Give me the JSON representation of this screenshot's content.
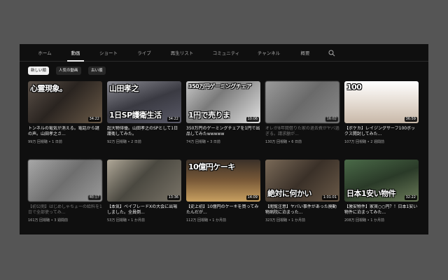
{
  "tabs": [
    {
      "label": "ホーム",
      "active": false
    },
    {
      "label": "動画",
      "active": true
    },
    {
      "label": "ショート",
      "active": false
    },
    {
      "label": "ライブ",
      "active": false
    },
    {
      "label": "再生リスト",
      "active": false
    },
    {
      "label": "コミュニティ",
      "active": false
    },
    {
      "label": "チャンネル",
      "active": false
    },
    {
      "label": "概要",
      "active": false
    }
  ],
  "search_icon": "search-icon",
  "chips": [
    {
      "label": "新しい順",
      "selected": true
    },
    {
      "label": "人気の動画",
      "selected": false
    },
    {
      "label": "古い順",
      "selected": false
    }
  ],
  "videos": [
    {
      "thumb_text": "心霊現象。",
      "thumb_text2": "",
      "duration": "34:22",
      "title": "トンネルの電気が消える。電話から謎の声。山田孝之さ...",
      "views": "99万 回視聴",
      "age": "1 日前",
      "dim": false
    },
    {
      "thumb_text": "山田孝之",
      "thumb_text2": "1日SP護衛生活",
      "duration": "34:22",
      "title": "超大物俳優。山田孝之のSPとして1日護衛してみた。",
      "views": "92万 回視聴",
      "age": "2 日前",
      "dim": false
    },
    {
      "thumb_text": "350万円ゲーミングチェア",
      "thumb_text2": "1円で売りま",
      "duration": "10:06",
      "title": "350万円のゲーミングチェアを1円で出品してみたwwwww",
      "views": "74万 回視聴",
      "age": "3 日前",
      "dim": false
    },
    {
      "thumb_text": "",
      "thumb_text2": "",
      "duration": "16:02",
      "title": "オレが8年間借りた家の退去費がヤバ過ぎる。請求額が...",
      "views": "130万 回視聴",
      "age": "6 日前",
      "dim": true
    },
    {
      "thumb_text": "100",
      "thumb_text2": "",
      "duration": "36:59",
      "title": "【ポケカ】レイジングサーフ100ボックス開封してみた...",
      "views": "107万 回視聴",
      "age": "2 週間前",
      "dim": false
    },
    {
      "thumb_text": "",
      "thumb_text2": "",
      "duration": "40:17",
      "title": "【初公開】はじめしゃちょーの給料を1日で全部使ってみ...",
      "views": "161万 回視聴",
      "age": "3 週間前",
      "dim": true
    },
    {
      "thumb_text": "",
      "thumb_text2": "",
      "duration": "13:36",
      "title": "【本気】ベイブレードXの大会に出場しました。全員倒...",
      "views": "53万 回視聴",
      "age": "1 か月前",
      "dim": false
    },
    {
      "thumb_text": "10億円ケーキ",
      "thumb_text2": "",
      "duration": "14:09",
      "title": "【史上初】10億円のケーキを買ってみたんだが...",
      "views": "112万 回視聴",
      "age": "1 か月前",
      "dim": false
    },
    {
      "thumb_text": "",
      "thumb_text2": "絶対に何かい",
      "duration": "1:01:01",
      "title": "【閲覧注意】ヤバい事件があった廃動物病院に泊まった...",
      "views": "323万 回視聴",
      "age": "1 か月前",
      "dim": false
    },
    {
      "thumb_text": "",
      "thumb_text2": "日本1安い物件",
      "duration": "32:22",
      "title": "【激安物件】家賃○○円？！日本1安い物件に泊まってみた...",
      "views": "208万 回視聴",
      "age": "1 か月前",
      "dim": false
    }
  ],
  "colors": {
    "background": "#0f0f0f",
    "page_border": "#555555",
    "text_primary": "#f1f1f1",
    "text_secondary": "#aaaaaa"
  }
}
